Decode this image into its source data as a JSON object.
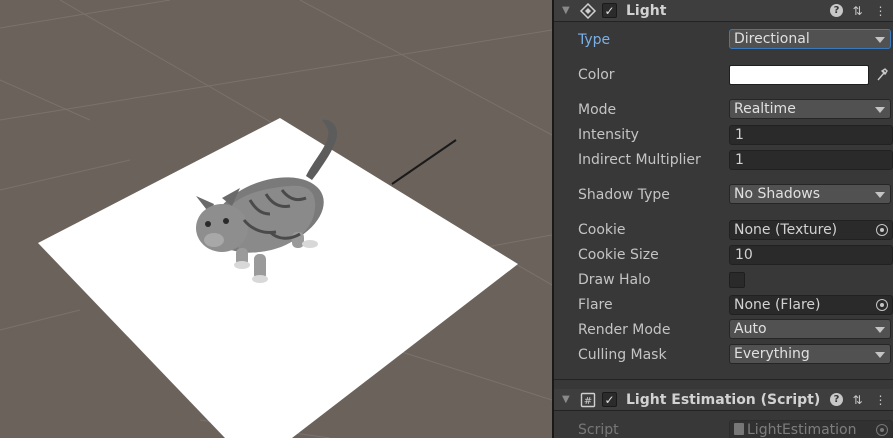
{
  "light_component": {
    "title": "Light",
    "enabled_check": "✓",
    "properties": {
      "type_label": "Type",
      "type_value": "Directional",
      "color_label": "Color",
      "color_value": "#ffffff",
      "mode_label": "Mode",
      "mode_value": "Realtime",
      "intensity_label": "Intensity",
      "intensity_value": "1",
      "indirect_label": "Indirect Multiplier",
      "indirect_value": "1",
      "shadow_label": "Shadow Type",
      "shadow_value": "No Shadows",
      "cookie_label": "Cookie",
      "cookie_value": "None (Texture)",
      "cookie_size_label": "Cookie Size",
      "cookie_size_value": "10",
      "draw_halo_label": "Draw Halo",
      "flare_label": "Flare",
      "flare_value": "None (Flare)",
      "render_mode_label": "Render Mode",
      "render_mode_value": "Auto",
      "culling_label": "Culling Mask",
      "culling_value": "Everything"
    }
  },
  "estimation_component": {
    "title": "Light Estimation (Script)",
    "enabled_check": "✓",
    "script_label": "Script",
    "script_value": "LightEstimation"
  },
  "icons": {
    "foldout": "▼",
    "light": "light-icon",
    "script": "script-icon",
    "help": "?",
    "presets": "⇅",
    "menu": "⋮",
    "eyedropper": "eyedropper-icon"
  },
  "colors": {
    "scene_bg": "#6b625b",
    "inspector_bg": "#383838",
    "highlight_label": "#7ab0e8",
    "focus_border": "#3a79bb"
  }
}
